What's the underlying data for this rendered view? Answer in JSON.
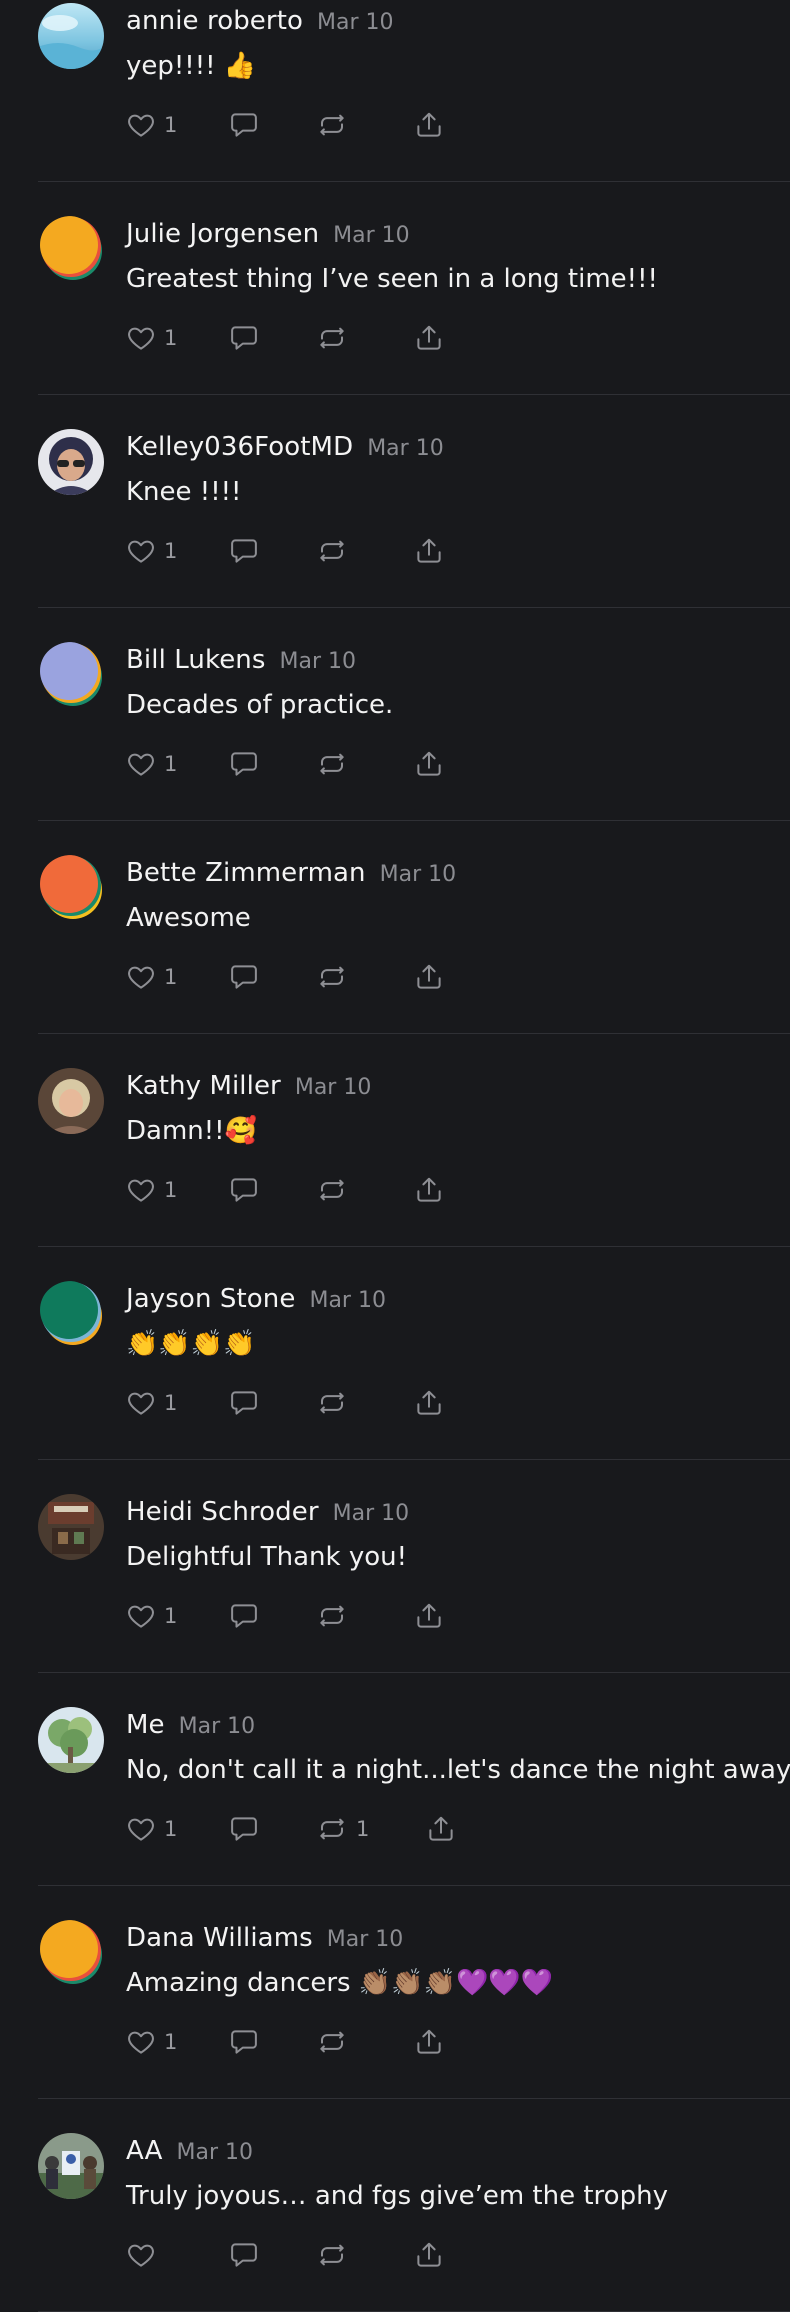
{
  "posts": [
    {
      "name": "annie roberto",
      "date": "Mar 10",
      "text": "yep!!!! 👍",
      "likes": "1",
      "reposts": "",
      "avatar": "sky"
    },
    {
      "name": "Julie Jorgensen",
      "date": "Mar 10",
      "text": "Greatest thing I’ve seen in a long time!!!",
      "likes": "1",
      "reposts": "",
      "avatar": "default-yellow"
    },
    {
      "name": "Kelley036FootMD",
      "date": "Mar 10",
      "text": "Knee !!!!",
      "likes": "1",
      "reposts": "",
      "avatar": "person-glasses"
    },
    {
      "name": "Bill Lukens",
      "date": "Mar 10",
      "text": "Decades of practice.",
      "likes": "1",
      "reposts": "",
      "avatar": "default-lavender"
    },
    {
      "name": "Bette Zimmerman",
      "date": "Mar 10",
      "text": "Awesome",
      "likes": "1",
      "reposts": "",
      "avatar": "default-orange"
    },
    {
      "name": "Kathy Miller",
      "date": "Mar 10",
      "text": "Damn!!🥰",
      "likes": "1",
      "reposts": "",
      "avatar": "person-blonde"
    },
    {
      "name": "Jayson Stone",
      "date": "Mar 10",
      "text": "👏👏👏👏",
      "likes": "1",
      "reposts": "",
      "avatar": "default-green"
    },
    {
      "name": "Heidi Schroder",
      "date": "Mar 10",
      "text": "Delightful Thank you!",
      "likes": "1",
      "reposts": "",
      "avatar": "photo-room"
    },
    {
      "name": "Me",
      "date": "Mar 10",
      "text": "No, don't call it a night...let's dance the night away.",
      "likes": "1",
      "reposts": "1",
      "avatar": "photo-tree"
    },
    {
      "name": "Dana Williams",
      "date": "Mar 10",
      "text": "Amazing dancers 👏🏽👏🏽👏🏽💜💜💜",
      "likes": "1",
      "reposts": "",
      "avatar": "default-yellow"
    },
    {
      "name": "AA",
      "date": "Mar 10",
      "text": "Truly joyous… and fgs give’em the trophy",
      "likes": "",
      "reposts": "",
      "avatar": "photo-crowd"
    }
  ],
  "colors": {
    "background": "#18191c",
    "divider": "#2f3035",
    "icon": "#8e8f94",
    "muted_text": "#8c8d92"
  }
}
